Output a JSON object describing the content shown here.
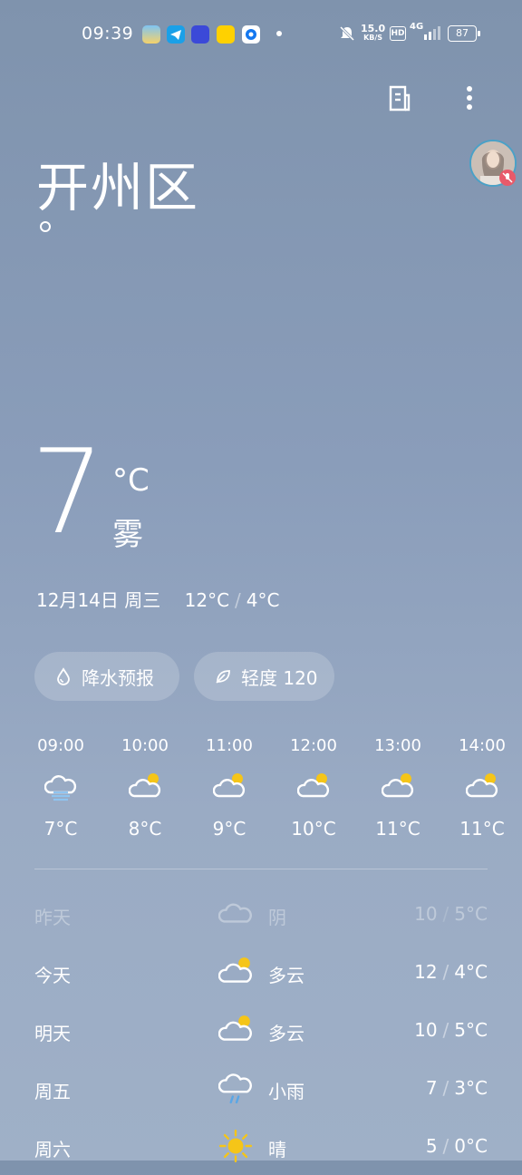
{
  "status_bar": {
    "time": "09:39",
    "net_speed_value": "15.0",
    "net_speed_unit": "KB/S",
    "hd_label": "HD",
    "network_label": "4G",
    "battery": "87"
  },
  "header": {
    "city": "开州区"
  },
  "current": {
    "temp": "7",
    "unit": "°C",
    "condition": "雾",
    "date": "12月14日 周三",
    "high": "12°C",
    "low": "4°C",
    "slash": "/"
  },
  "pills": {
    "precip_label": "降水预报",
    "aqi_label": "轻度 120"
  },
  "hourly": [
    {
      "time": "09:00",
      "icon": "fog-cloud-icon",
      "temp": "7°C"
    },
    {
      "time": "10:00",
      "icon": "partly-cloudy-icon",
      "temp": "8°C"
    },
    {
      "time": "11:00",
      "icon": "partly-cloudy-icon",
      "temp": "9°C"
    },
    {
      "time": "12:00",
      "icon": "partly-cloudy-icon",
      "temp": "10°C"
    },
    {
      "time": "13:00",
      "icon": "partly-cloudy-icon",
      "temp": "11°C"
    },
    {
      "time": "14:00",
      "icon": "partly-cloudy-icon",
      "temp": "11°C"
    }
  ],
  "daily": [
    {
      "name": "昨天",
      "icon": "cloud-icon",
      "cond": "阴",
      "high": "10",
      "low": "5°C"
    },
    {
      "name": "今天",
      "icon": "partly-cloudy-icon",
      "cond": "多云",
      "high": "12",
      "low": "4°C"
    },
    {
      "name": "明天",
      "icon": "partly-cloudy-icon",
      "cond": "多云",
      "high": "10",
      "low": "5°C"
    },
    {
      "name": "周五",
      "icon": "light-rain-icon",
      "cond": "小雨",
      "high": "7",
      "low": "3°C"
    },
    {
      "name": "周六",
      "icon": "sun-icon",
      "cond": "晴",
      "high": "5",
      "low": "0°C"
    }
  ],
  "colors": {
    "sun": "#f5c518",
    "rain": "#5aa7e6",
    "fog": "#8fc4f0",
    "avatar_ring": "#4aa1c7",
    "badge": "#e85a6a"
  }
}
